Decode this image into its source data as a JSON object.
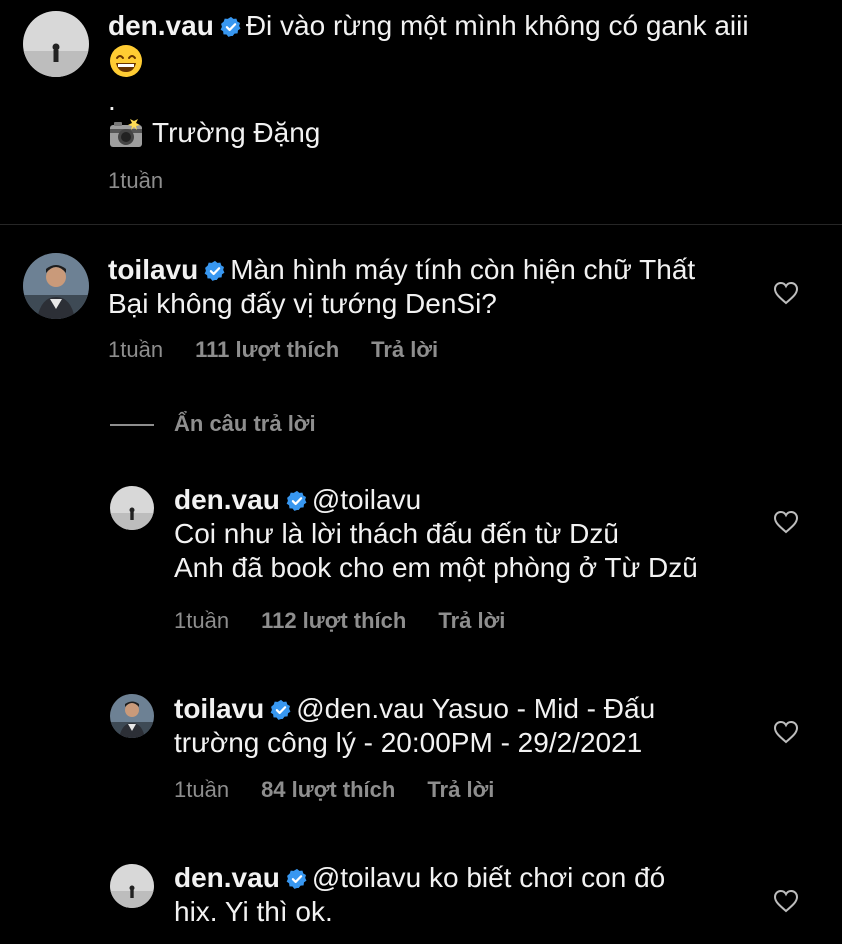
{
  "caption": {
    "username": "den.vau",
    "text": "Đi vào rừng một mình không có gank aiii",
    "dot": ".",
    "credit": "Trường Đặng",
    "time": "1tuần"
  },
  "comments": [
    {
      "username": "toilavu",
      "text_line1": "Màn hình máy tính còn hiện chữ Thất",
      "text_line2": "Bại không đấy vị tướng DenSi?",
      "time": "1tuần",
      "likes": "111 lượt thích",
      "reply": "Trả lời"
    }
  ],
  "hide_replies": "Ẩn câu trả lời",
  "replies": [
    {
      "username": "den.vau",
      "mention": "@toilavu",
      "line2": "Coi như là lời thách đấu đến từ Dzũ",
      "line3": "Anh đã book cho em một phòng ở Từ Dzũ",
      "time": "1tuần",
      "likes": "112 lượt thích",
      "reply": "Trả lời"
    },
    {
      "username": "toilavu",
      "line1_rest": "@den.vau Yasuo - Mid - Đấu",
      "line2": "trường công lý - 20:00PM - 29/2/2021",
      "time": "1tuần",
      "likes": "84 lượt thích",
      "reply": "Trả lời"
    },
    {
      "username": "den.vau",
      "mention": "@toilavu",
      "line1_rest": "ko biết chơi con đó",
      "line2": "hix. Yi thì ok."
    }
  ],
  "icons": {
    "verified": "verified-badge-icon",
    "heart": "heart-outline-icon",
    "grin": "grinning-emoji-icon",
    "camera": "camera-flash-emoji-icon"
  },
  "colors": {
    "background": "#000000",
    "text": "#f5f5f5",
    "secondary": "#8e8e8e",
    "verified": "#3897f0"
  }
}
